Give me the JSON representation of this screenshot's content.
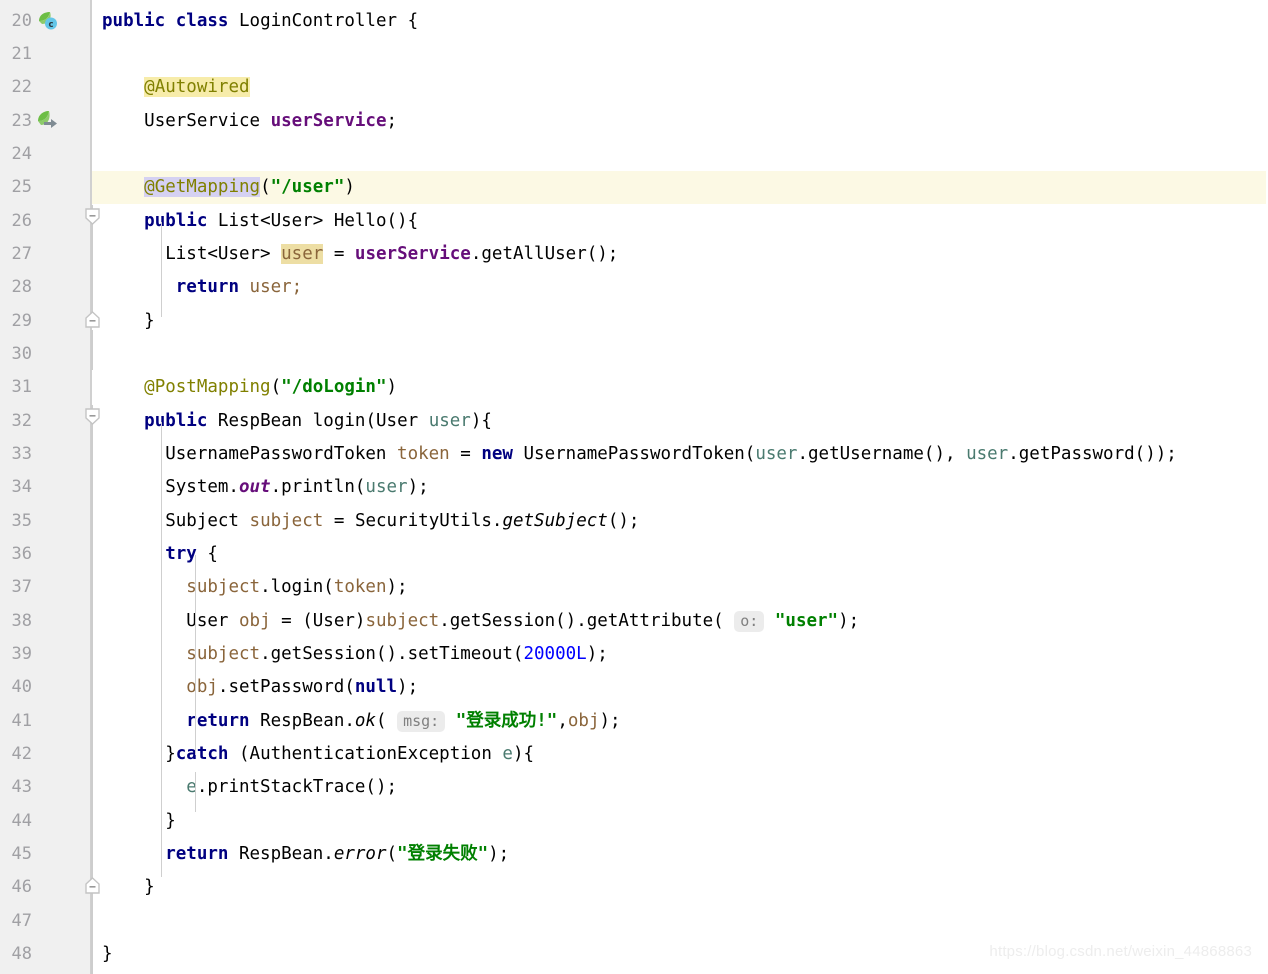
{
  "editor": {
    "language": "java",
    "theme": "IntelliJ Light",
    "colors": {
      "background": "#ffffff",
      "gutter_background": "#f0f0f0",
      "line_number": "#a0a0a4",
      "current_line_highlight": "#fcf9e4",
      "keyword": "#000080",
      "annotation": "#808000",
      "string": "#008000",
      "field": "#660e7a",
      "static_field": "#660e7a",
      "local_variable": "#8a653b",
      "parameter": "#4a7a6f",
      "number": "#0000ff",
      "annotation_highlight": "#f7ecaa",
      "selection_highlight": "#d5d1f2",
      "identifier_highlight": "#eddea4",
      "param_hint_background": "#ececec",
      "param_hint_text": "#808080",
      "indent_guide": "#cfcfcf",
      "fold_marker": "#cdcdcd"
    },
    "first_line": 20,
    "last_line": 48,
    "current_line": 25,
    "line_height": 33
  },
  "line_numbers": [
    20,
    21,
    22,
    23,
    24,
    25,
    26,
    27,
    28,
    29,
    30,
    31,
    32,
    33,
    34,
    35,
    36,
    37,
    38,
    39,
    40,
    41,
    42,
    43,
    44,
    45,
    46,
    47,
    48
  ],
  "gutter_icons": [
    {
      "line": 20,
      "name": "spring-bean-class-icon",
      "description": "Spring component class marker"
    },
    {
      "line": 23,
      "name": "spring-autowired-dependency-icon",
      "description": "Autowired dependency navigation marker"
    }
  ],
  "fold_markers": [
    {
      "line": 26,
      "type": "fold-start",
      "name": "fold-collapse-hello-method"
    },
    {
      "line": 29,
      "type": "fold-end",
      "name": "fold-end-hello-method"
    },
    {
      "line": 32,
      "type": "fold-start",
      "name": "fold-collapse-login-method"
    },
    {
      "line": 46,
      "type": "fold-end",
      "name": "fold-end-login-method"
    }
  ],
  "code_lines": [
    {
      "number": 20,
      "text": "public class LoginController {"
    },
    {
      "number": 21,
      "text": ""
    },
    {
      "number": 22,
      "text": "    @Autowired"
    },
    {
      "number": 23,
      "text": "    UserService userService;"
    },
    {
      "number": 24,
      "text": ""
    },
    {
      "number": 25,
      "text": "    @GetMapping(\"/user\")"
    },
    {
      "number": 26,
      "text": "    public List<User> Hello(){"
    },
    {
      "number": 27,
      "text": "        List<User> user = userService.getAllUser();"
    },
    {
      "number": 28,
      "text": "         return user;"
    },
    {
      "number": 29,
      "text": "    }"
    },
    {
      "number": 30,
      "text": ""
    },
    {
      "number": 31,
      "text": "    @PostMapping(\"/doLogin\")"
    },
    {
      "number": 32,
      "text": "    public RespBean login(User user){"
    },
    {
      "number": 33,
      "text": "        UsernamePasswordToken token = new UsernamePasswordToken(user.getUsername(), user.getPassword());"
    },
    {
      "number": 34,
      "text": "        System.out.println(user);"
    },
    {
      "number": 35,
      "text": "        Subject subject = SecurityUtils.getSubject();"
    },
    {
      "number": 36,
      "text": "        try {"
    },
    {
      "number": 37,
      "text": "            subject.login(token);"
    },
    {
      "number": 38,
      "text": "            User obj = (User)subject.getSession().getAttribute( o: \"user\");"
    },
    {
      "number": 39,
      "text": "            subject.getSession().setTimeout(20000L);"
    },
    {
      "number": 40,
      "text": "            obj.setPassword(null);"
    },
    {
      "number": 41,
      "text": "            return RespBean.ok( msg: \"登录成功!\",obj);"
    },
    {
      "number": 42,
      "text": "        }catch (AuthenticationException e){"
    },
    {
      "number": 43,
      "text": "            e.printStackTrace();"
    },
    {
      "number": 44,
      "text": "        }"
    },
    {
      "number": 45,
      "text": "        return RespBean.error(\"登录失败\");"
    },
    {
      "number": 46,
      "text": "    }"
    },
    {
      "number": 47,
      "text": ""
    },
    {
      "number": 48,
      "text": "}"
    }
  ],
  "parameter_hints": [
    {
      "line": 38,
      "label": "o:"
    },
    {
      "line": 41,
      "label": "msg:"
    }
  ],
  "strings": {
    "user_path": "\"/user\"",
    "dologin_path": "\"/doLogin\"",
    "user_attr": "\"user\"",
    "login_success": "\"登录成功!\"",
    "login_failure": "\"登录失败\"",
    "timeout": "20000L"
  },
  "watermark": "https://blog.csdn.net/weixin_44868863",
  "l20": {
    "kw1": "public",
    "kw2": "class",
    "name": "LoginController",
    "brace": "{"
  },
  "l22": {
    "ann": "@Autowired"
  },
  "l23": {
    "type": "UserService",
    "field": "userService",
    "semi": ";"
  },
  "l25": {
    "ann": "@GetMapping",
    "open": "(",
    "str": "\"/user\"",
    "close": ")"
  },
  "l26": {
    "kw": "public",
    "type": "List<User>",
    "name": "Hello",
    "tail": "(){"
  },
  "l27": {
    "type": "List<User>",
    "var": "user",
    "eq": "=",
    "field": "userService",
    "dot": ".",
    "call": "getAllUser();"
  },
  "l28": {
    "kw": "return",
    "var": "user;"
  },
  "l29": {
    "brace": "}"
  },
  "l31": {
    "ann": "@PostMapping",
    "open": "(",
    "str": "\"/doLogin\"",
    "close": ")"
  },
  "l32": {
    "kw": "public",
    "type": "RespBean",
    "name": "login",
    "open": "(",
    "ptype": "User",
    "pname": "user",
    "tail": "){"
  },
  "l33": {
    "type": "UsernamePasswordToken",
    "var": "token",
    "eq": "=",
    "kw": "new",
    "ctor": "UsernamePasswordToken",
    "open": "(",
    "p1": "user",
    "m1": ".getUsername(),",
    "p2": "user",
    "m2": ".getPassword());"
  },
  "l34": {
    "cls": "System.",
    "stat": "out",
    "rest": ".println(",
    "p": "user",
    "tail": ");"
  },
  "l35": {
    "type": "Subject",
    "var": "subject",
    "eq": "=",
    "cls": "SecurityUtils.",
    "m": "getSubject",
    "tail": "();"
  },
  "l36": {
    "kw": "try",
    "brace": "{"
  },
  "l37": {
    "var": "subject",
    "m": ".login(",
    "arg": "token",
    "tail": ");"
  },
  "l38": {
    "type": "User",
    "var": "obj",
    "eq": "= (",
    "cast": "User",
    "castclose": ")",
    "subj": "subject",
    "chain": ".getSession().getAttribute(",
    "hint": "o:",
    "str": "\"user\"",
    "tail": ");"
  },
  "l39": {
    "var": "subject",
    "chain": ".getSession().setTimeout(",
    "num": "20000L",
    "tail": ");"
  },
  "l40": {
    "var": "obj",
    "m": ".setPassword(",
    "kw": "null",
    "tail": ");"
  },
  "l41": {
    "kw": "return",
    "cls": "RespBean.",
    "m": "ok",
    "open": "(",
    "hint": "msg:",
    "str": "\"登录成功!\"",
    "comma": ",",
    "arg": "obj",
    "tail": ");"
  },
  "l42": {
    "brace": "}",
    "kw": "catch",
    "open": " (",
    "ex": "AuthenticationException",
    "var": "e",
    "tail": "){"
  },
  "l43": {
    "var": "e",
    "m": ".printStackTrace();"
  },
  "l44": {
    "brace": "}"
  },
  "l45": {
    "kw": "return",
    "cls": "RespBean.",
    "m": "error",
    "open": "(",
    "str": "\"登录失败\"",
    "tail": ");"
  },
  "l46": {
    "brace": "}"
  },
  "l48": {
    "brace": "}"
  }
}
